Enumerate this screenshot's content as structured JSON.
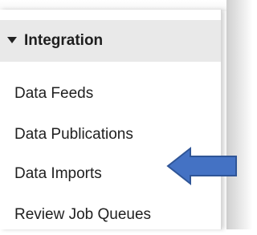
{
  "menu": {
    "header": {
      "label": "Integration",
      "expanded": true,
      "icon": "caret-down-icon"
    },
    "items": [
      {
        "label": "Data Feeds"
      },
      {
        "label": "Data Publications"
      },
      {
        "label": "Data Imports"
      },
      {
        "label": "Review Job Queues"
      }
    ]
  },
  "annotation": {
    "icon": "left-arrow-icon",
    "color": "#4472c4",
    "points_to": "Data Imports"
  }
}
